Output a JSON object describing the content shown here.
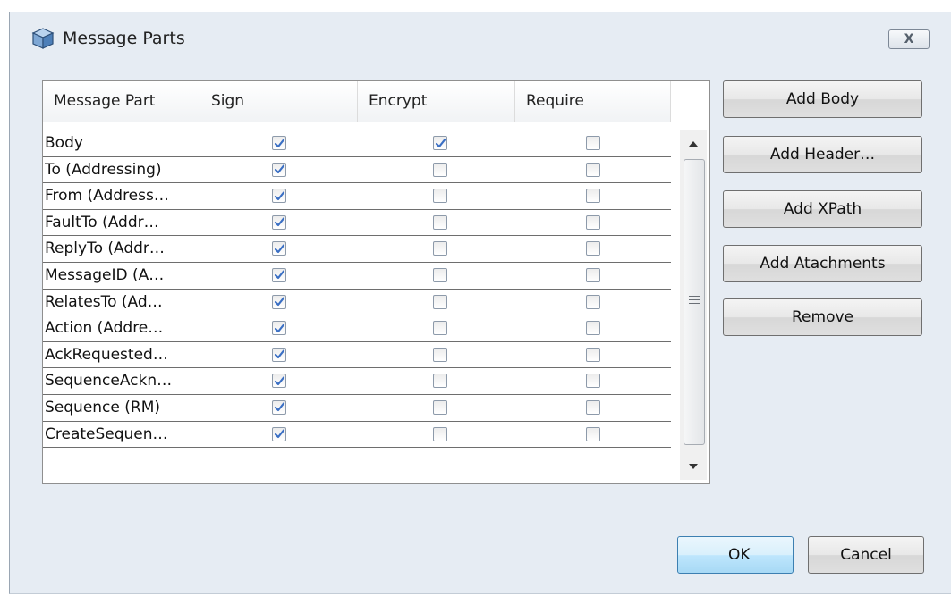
{
  "window": {
    "title": "Message Parts",
    "close_label": "X"
  },
  "table": {
    "columns": [
      "Message Part",
      "Sign",
      "Encrypt",
      "Require"
    ],
    "rows": [
      {
        "label": "Body",
        "sign": true,
        "encrypt": true,
        "require": false
      },
      {
        "label": "To (Addressing)",
        "sign": true,
        "encrypt": false,
        "require": false
      },
      {
        "label": "From (Address…",
        "sign": true,
        "encrypt": false,
        "require": false
      },
      {
        "label": "FaultTo (Addr…",
        "sign": true,
        "encrypt": false,
        "require": false
      },
      {
        "label": "ReplyTo (Addr…",
        "sign": true,
        "encrypt": false,
        "require": false
      },
      {
        "label": "MessageID (A…",
        "sign": true,
        "encrypt": false,
        "require": false
      },
      {
        "label": "RelatesTo (Ad…",
        "sign": true,
        "encrypt": false,
        "require": false
      },
      {
        "label": "Action (Addre…",
        "sign": true,
        "encrypt": false,
        "require": false
      },
      {
        "label": "AckRequested…",
        "sign": true,
        "encrypt": false,
        "require": false
      },
      {
        "label": "SequenceAckn…",
        "sign": true,
        "encrypt": false,
        "require": false
      },
      {
        "label": "Sequence (RM)",
        "sign": true,
        "encrypt": false,
        "require": false
      },
      {
        "label": "CreateSequen…",
        "sign": true,
        "encrypt": false,
        "require": false
      }
    ]
  },
  "buttons": {
    "add_body": "Add Body",
    "add_header": "Add Header…",
    "add_xpath": "Add XPath",
    "add_attachments": "Add Atachments",
    "remove": "Remove",
    "ok": "OK",
    "cancel": "Cancel"
  },
  "colors": {
    "dialog_bg": "#e6ecf3",
    "check_mark": "#3a6fc4",
    "ok_border": "#3c7fb1"
  }
}
